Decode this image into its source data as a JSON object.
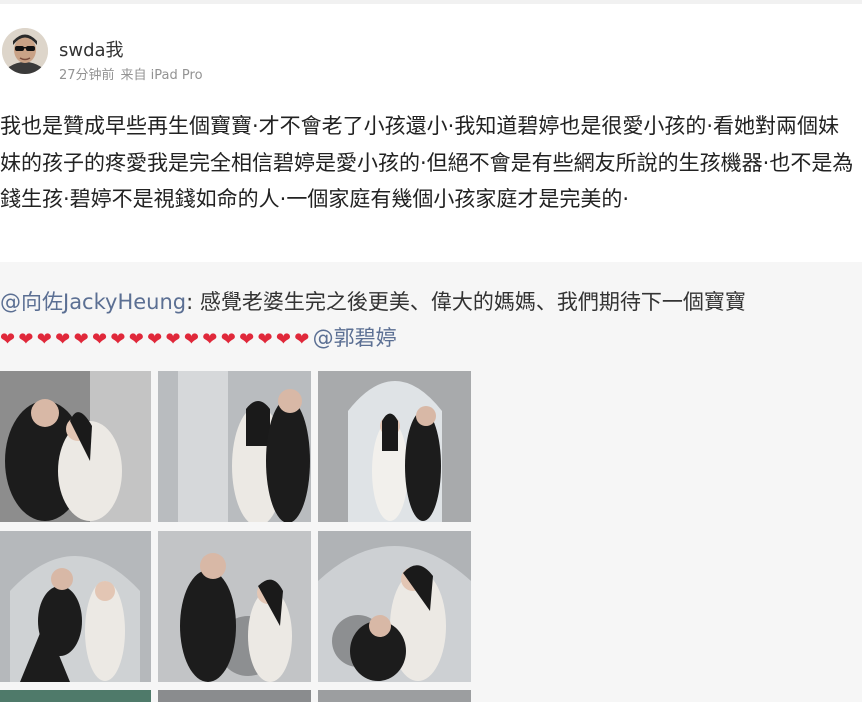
{
  "post": {
    "user": {
      "name": "swda我",
      "avatar_icon": "avatar-sunglasses-man-icon"
    },
    "meta": {
      "time": "27分钟前",
      "source": "来自 iPad Pro"
    },
    "text": "我也是贊成早些再生個寶寶·才不會老了小孩還小·我知道碧婷也是很愛小孩的·看她對兩個妹妹的孩子的疼愛我是完全相信碧婷是愛小孩的·但絕不會是有些網友所說的生孩機器·也不是為錢生孩·碧婷不是視錢如命的人·一個家庭有幾個小孩家庭才是完美的·"
  },
  "repost": {
    "author_mention": "@向佐JackyHeung",
    "body": ": 感覺老婆生完之後更美、偉大的媽媽、我們期待下一個寶寶",
    "heart_count": 17,
    "heart_icon": "red-heart-icon",
    "heart_color": "#e0283a",
    "end_mention": "@郭碧婷"
  },
  "colors": {
    "link": "#5b6f93",
    "repost_bg": "#f6f6f6",
    "meta_text": "#939393"
  }
}
